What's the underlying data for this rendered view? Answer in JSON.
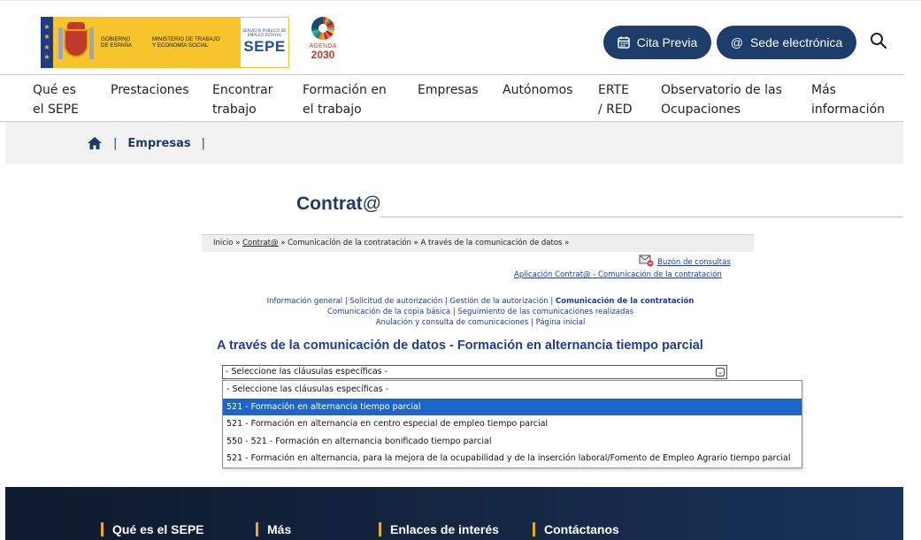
{
  "header": {
    "gov_line1": "GOBIERNO",
    "gov_line2": "DE ESPAÑA",
    "ministry": "MINISTERIO DE TRABAJO Y ECONOMÍA SOCIAL",
    "sepe_small": "SERVICIO PÚBLICO DE EMPLEO ESTATAL",
    "sepe_big": "SEPE",
    "agenda_label": "AGENDA",
    "agenda_year": "2030",
    "cita_label": "Cita Previa",
    "sede_label": "Sede electrónica",
    "brand_color": "#1d3d6a"
  },
  "nav": {
    "items": [
      {
        "label": "Qué es\nel SEPE"
      },
      {
        "label": "Prestaciones"
      },
      {
        "label": "Encontrar\ntrabajo"
      },
      {
        "label": "Formación en\nel trabajo"
      },
      {
        "label": "Empresas"
      },
      {
        "label": "Autónomos"
      },
      {
        "label": "ERTE\n/ RED"
      },
      {
        "label": "Observatorio de las\nOcupaciones"
      },
      {
        "label": "Más\ninformación"
      }
    ]
  },
  "breadcrumb": {
    "sep": "|",
    "current": "Empresas"
  },
  "page": {
    "title_main": "Contrat",
    "title_at": "@"
  },
  "app": {
    "crumb_start": "Inicio » ",
    "crumb_link": "Contrat@",
    "crumb_rest": " » Comunicación de la contratación » A través de la comunicación de datos »",
    "buzon": "Buzón de consultas",
    "app_link": "Aplicación Contrat@ - Comunicación de la contratación",
    "menu": {
      "info": "Información general",
      "solicitud": "Solicitud de autorización",
      "gestion": "Gestión de la autorización",
      "comunicacion": "Comunicación de la contratación",
      "copia": "Comunicación de la copia básica",
      "seguimiento": "Seguimiento de las comunicaciones realizadas",
      "anulacion": "Anulación y consulta de comunicaciones",
      "inicial": "Página inicial",
      "sep": "|"
    },
    "section_title": "A través de la comunicación de datos - Formación en alternancia tiempo parcial",
    "select_value": "- Seleccione las cláusulas específicas -",
    "options": [
      "- Seleccione las cláusulas específicas -",
      "521 - Formación en alternancia tiempo parcial",
      "521 - Formación en alternancia en centro especial de empleo tiempo parcial",
      "550 - 521 - Formación en alternancia bonificado tiempo parcial",
      "521 - Formación en alternancia, para la mejora de la ocupabilidad y de la inserción laboral/Fomento de Empleo Agrario tiempo parcial"
    ],
    "selected_index": 1
  },
  "footer": {
    "items": [
      "Qué es el SEPE",
      "Más",
      "Enlaces de interés",
      "Contáctanos"
    ],
    "accent": "#f0a91b"
  }
}
